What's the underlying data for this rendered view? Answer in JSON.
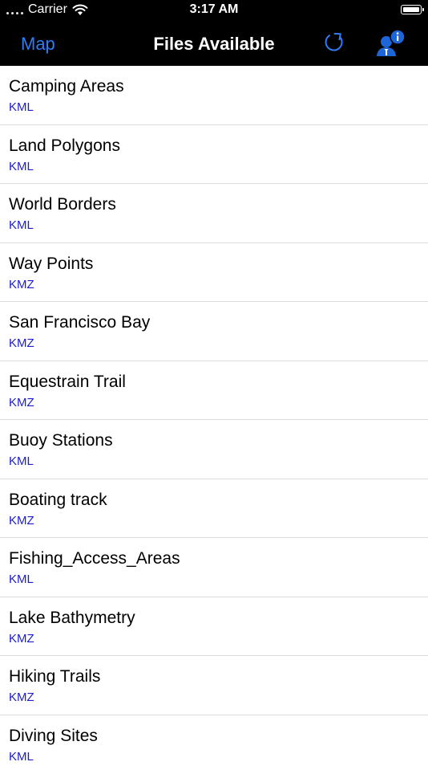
{
  "status": {
    "carrier": "Carrier",
    "time": "3:17 AM"
  },
  "nav": {
    "back_label": "Map",
    "title": "Files Available",
    "refresh_icon": "refresh-icon",
    "info_icon": "user-info-icon"
  },
  "colors": {
    "accent": "#2f7cf6",
    "subtitle": "#1c1cc9",
    "bar_bg": "#000000"
  },
  "files": [
    {
      "name": "Camping Areas",
      "type": "KML"
    },
    {
      "name": "Land Polygons",
      "type": "KML"
    },
    {
      "name": "World Borders",
      "type": "KML"
    },
    {
      "name": "Way Points",
      "type": "KMZ"
    },
    {
      "name": "San Francisco Bay",
      "type": "KMZ"
    },
    {
      "name": "Equestrain Trail",
      "type": "KMZ"
    },
    {
      "name": "Buoy Stations",
      "type": "KML"
    },
    {
      "name": "Boating track",
      "type": "KMZ"
    },
    {
      "name": "Fishing_Access_Areas",
      "type": "KML"
    },
    {
      "name": "Lake Bathymetry",
      "type": "KMZ"
    },
    {
      "name": "Hiking Trails",
      "type": "KMZ"
    },
    {
      "name": "Diving Sites",
      "type": "KML"
    }
  ]
}
